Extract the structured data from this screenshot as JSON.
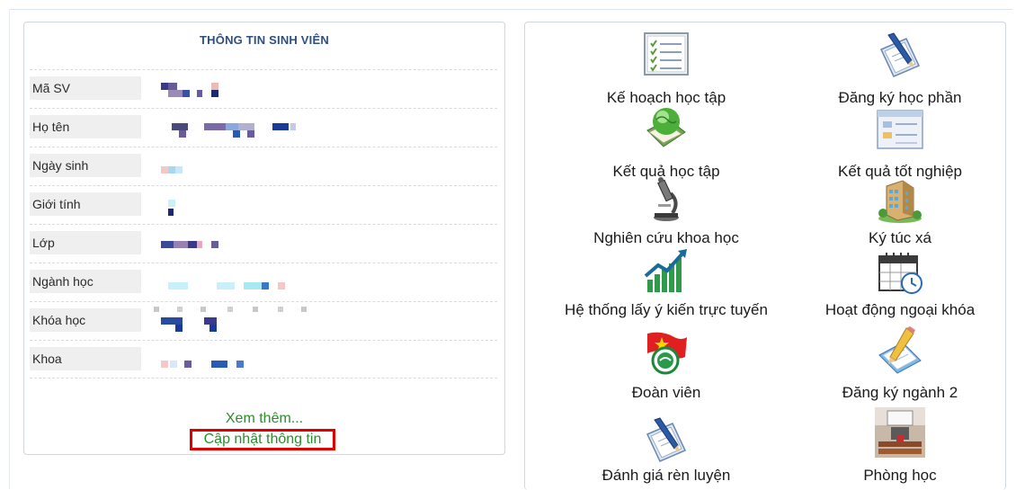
{
  "student_info": {
    "title": "THÔNG TIN SINH VIÊN",
    "rows": [
      {
        "label": "Mã SV"
      },
      {
        "label": "Họ tên"
      },
      {
        "label": "Ngày sinh"
      },
      {
        "label": "Giới tính"
      },
      {
        "label": "Lớp"
      },
      {
        "label": "Ngành học"
      },
      {
        "label": "Khóa học"
      },
      {
        "label": "Khoa"
      }
    ],
    "more_link": "Xem thêm...",
    "update_link": "Cập nhật thông tin"
  },
  "menu": {
    "items": [
      {
        "label": "Kế hoạch học tập",
        "icon": "checklist-icon"
      },
      {
        "label": "Đăng ký học phần",
        "icon": "pen-paper-icon"
      },
      {
        "label": "Kết quả học tập",
        "icon": "globe-book-icon"
      },
      {
        "label": "Kết quả tốt nghiệp",
        "icon": "window-form-icon"
      },
      {
        "label": "Nghiên cứu khoa học",
        "icon": "microscope-icon"
      },
      {
        "label": "Ký túc xá",
        "icon": "building-icon"
      },
      {
        "label": "Hệ thống lấy ý kiến trực tuyến",
        "icon": "growth-chart-icon"
      },
      {
        "label": "Hoạt động ngoại khóa",
        "icon": "calendar-clock-icon"
      },
      {
        "label": "Đoàn viên",
        "icon": "youth-union-badge-icon"
      },
      {
        "label": "Đăng ký ngành 2",
        "icon": "pencil-notebook-icon"
      },
      {
        "label": "Đánh giá rèn luyện",
        "icon": "pen-paper-icon"
      },
      {
        "label": "Phòng học",
        "icon": "classroom-icon"
      }
    ]
  }
}
